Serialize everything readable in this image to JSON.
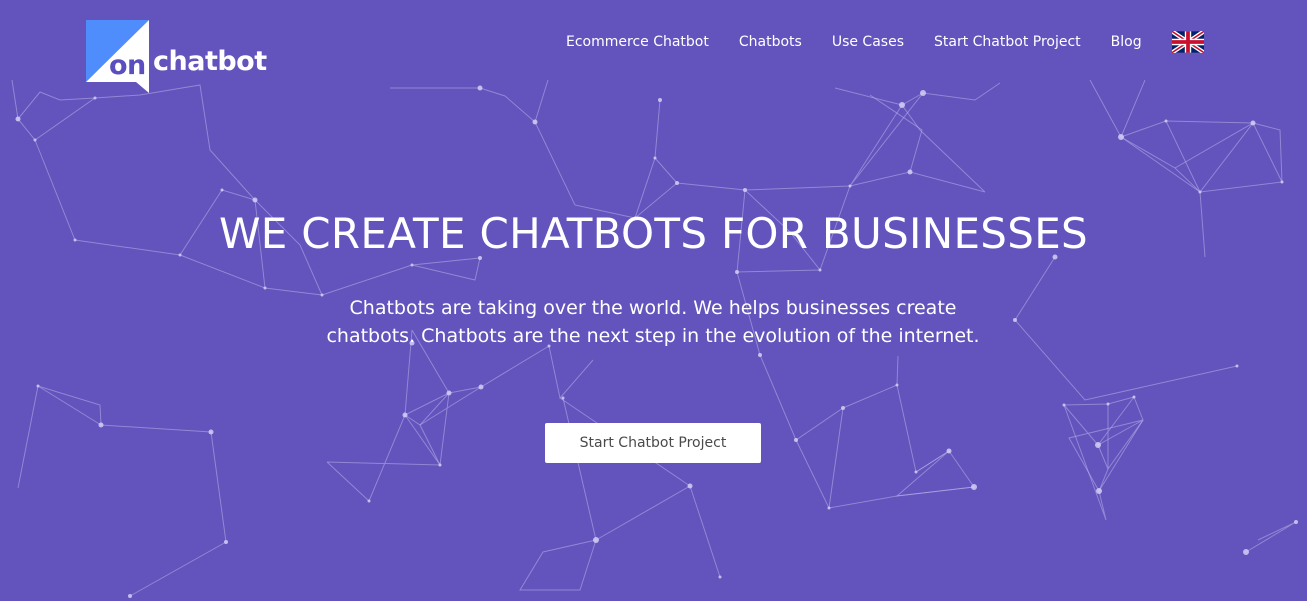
{
  "header": {
    "logo": {
      "text_on": "on",
      "text_rest": "chatbot"
    },
    "nav": [
      {
        "label": "Ecommerce Chatbot"
      },
      {
        "label": "Chatbots"
      },
      {
        "label": "Use Cases"
      },
      {
        "label": "Start Chatbot Project"
      },
      {
        "label": "Blog"
      }
    ],
    "language_flag": "uk-flag-icon"
  },
  "hero": {
    "title": "WE CREATE CHATBOTS FOR BUSINESSES",
    "subtitle": "Chatbots are taking over the world. We helps businesses create chatbots. Chatbots are the next step in the evolution of the internet.",
    "cta_label": "Start Chatbot Project"
  },
  "colors": {
    "background": "#6253bd",
    "logo_blue": "#4f8dfd",
    "white": "#ffffff"
  }
}
